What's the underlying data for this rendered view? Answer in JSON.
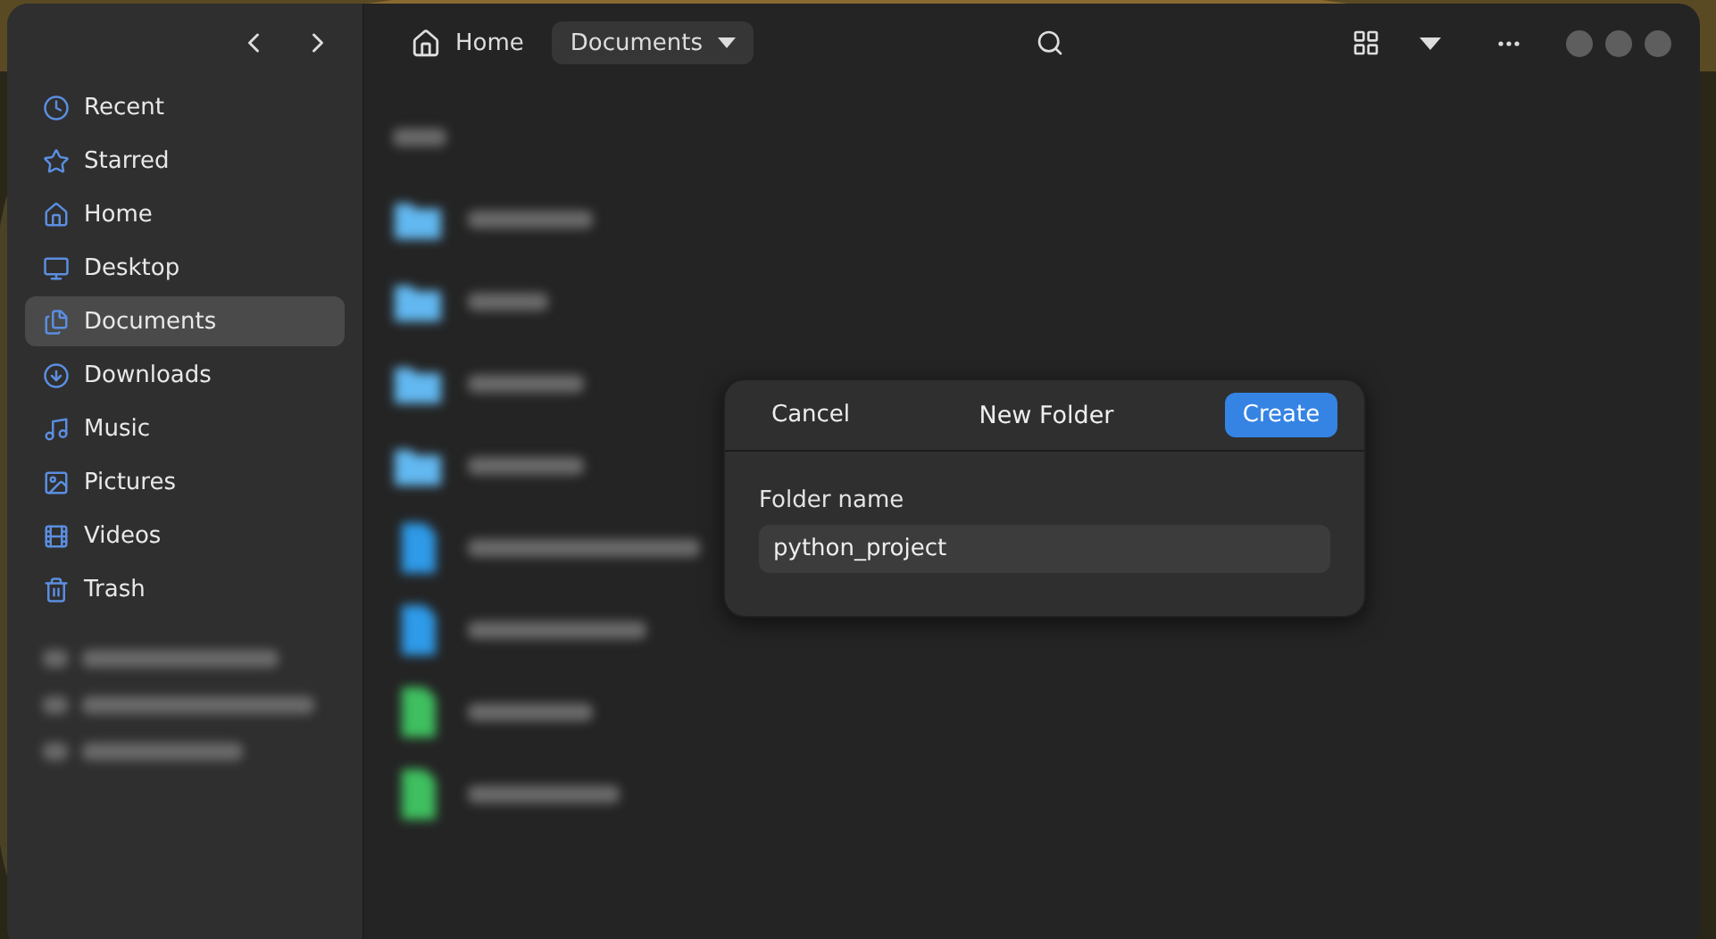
{
  "sidebar": {
    "items": [
      {
        "label": "Recent",
        "selected": false
      },
      {
        "label": "Starred",
        "selected": false
      },
      {
        "label": "Home",
        "selected": false
      },
      {
        "label": "Desktop",
        "selected": false
      },
      {
        "label": "Documents",
        "selected": true
      },
      {
        "label": "Downloads",
        "selected": false
      },
      {
        "label": "Music",
        "selected": false
      },
      {
        "label": "Pictures",
        "selected": false
      },
      {
        "label": "Videos",
        "selected": false
      },
      {
        "label": "Trash",
        "selected": false
      }
    ]
  },
  "path_bar": {
    "home": "Home",
    "current": "Documents"
  },
  "files": [
    {
      "kind": "folder"
    },
    {
      "kind": "folder"
    },
    {
      "kind": "folder"
    },
    {
      "kind": "folder"
    },
    {
      "kind": "document"
    },
    {
      "kind": "document"
    },
    {
      "kind": "sheet"
    },
    {
      "kind": "sheet"
    }
  ],
  "dialog": {
    "title": "New Folder",
    "cancel": "Cancel",
    "confirm": "Create",
    "field_label": "Folder name",
    "value": "python_project"
  }
}
